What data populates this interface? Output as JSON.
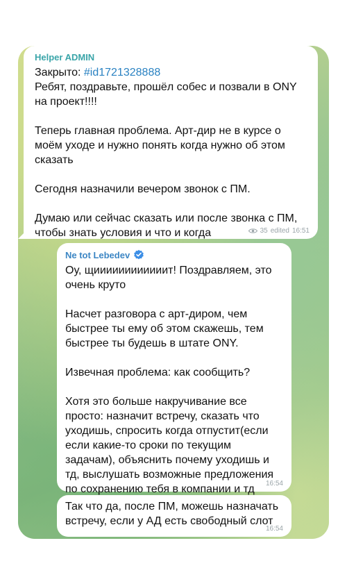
{
  "messages": [
    {
      "sender": "Helper ADMIN",
      "status_prefix": "Закрыто: ",
      "hashtag": "#id1721328888",
      "body": "Ребят, поздравьте, прошёл собес и позвали в ONY на проект!!!!\n\nТеперь главная проблема. Арт-дир не в курсе о моём уходе и нужно понять когда нужно об этом сказать\n\nСегодня назначили вечером звонок с ПМ.\n\nДумаю или сейчас сказать или после звонка с ПМ, чтобы знать условия и что и когда",
      "views": "35",
      "edited": "edited",
      "time": "16:51"
    },
    {
      "sender": "Ne tot Lebedev",
      "verified": true,
      "body": "Оу, щиииииииииииит! Поздравляем, это очень круто\n\nНасчет разговора с арт-диром, чем быстрее ты ему об этом скажешь, тем быстрее ты будешь в штате ONY.\n\nИзвечная проблема: как сообщить?\n\nХотя это больше накручивание все просто: назначит встречу, сказать что уходишь, спросить когда отпустит(если если какие-то сроки по текущим задачам), объяснить почему уходишь и тд, выслушать возможные предложения по сохранению тебя в компании и тд",
      "time": "16:54"
    },
    {
      "body": "Так что да, после ПМ, можешь назначать встречу, если у АД есть свободный слот",
      "time": "16:54"
    }
  ],
  "colors": {
    "admin_name": "#3aa5a9",
    "user_name": "#3c86c4",
    "hashtag": "#2a82c2",
    "verified_badge": "#3c8ee6",
    "bubble": "#ffffff",
    "meta_text": "#9aa4a8"
  },
  "icons": {
    "views": "eye-icon",
    "verified": "verified-badge-icon"
  }
}
